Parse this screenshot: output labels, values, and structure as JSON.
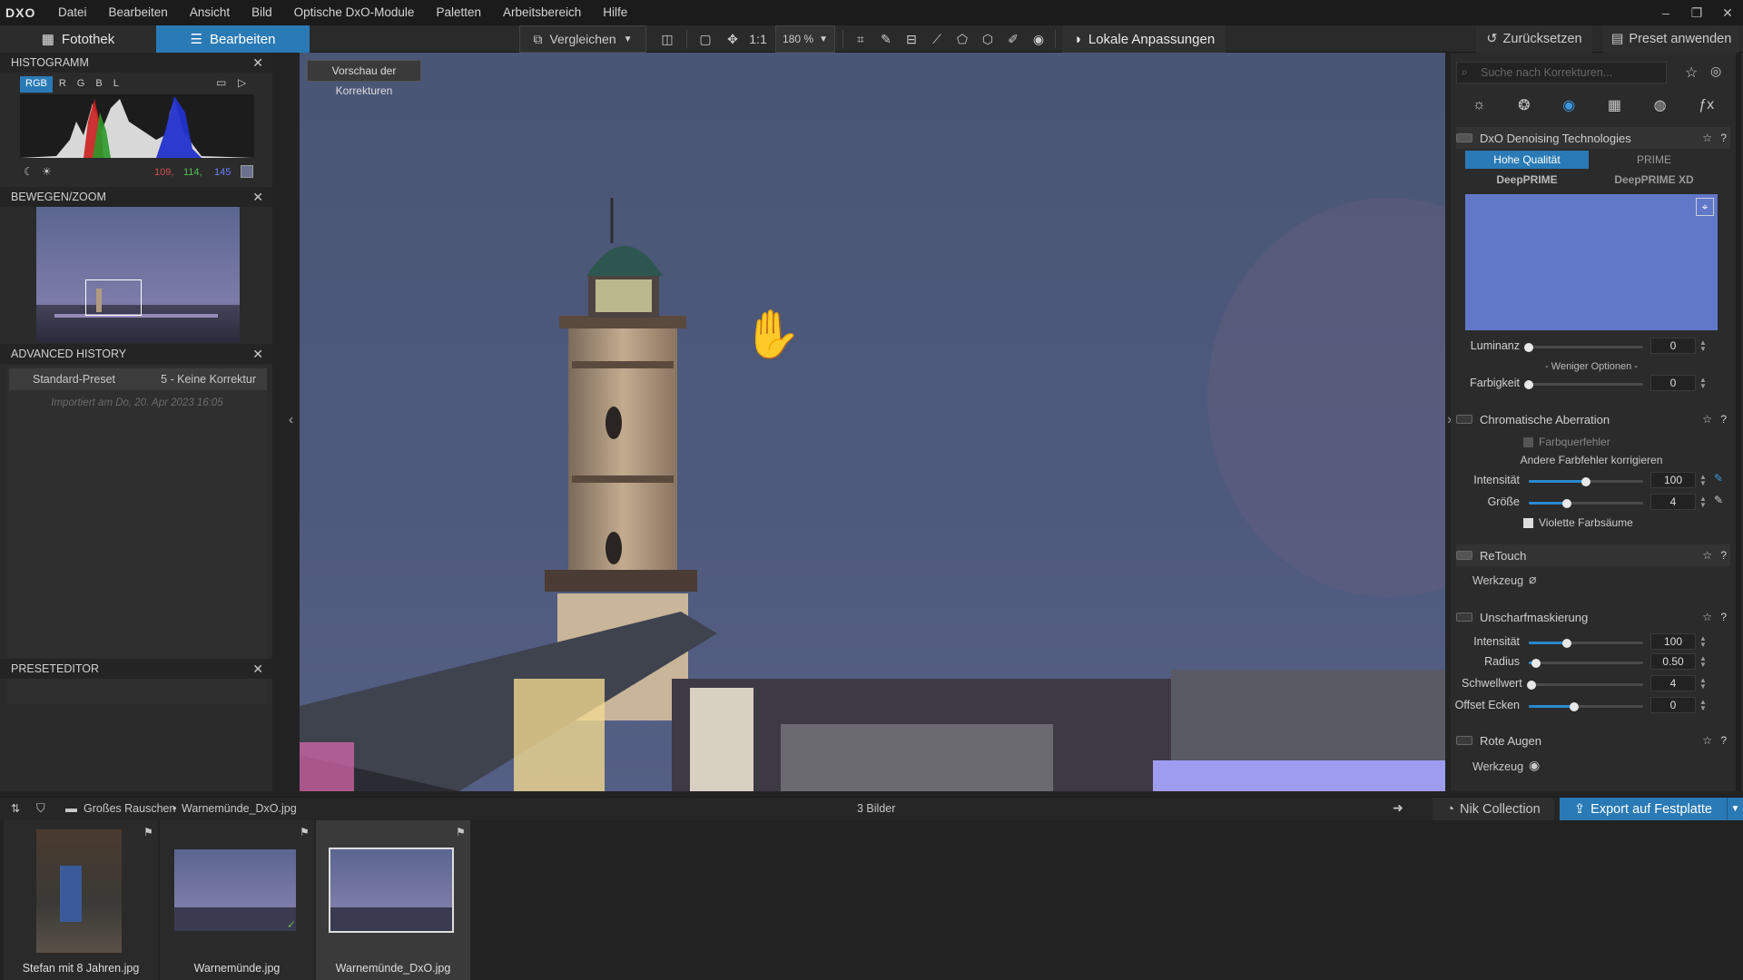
{
  "app": {
    "logo": "DXO"
  },
  "menu": [
    "Datei",
    "Bearbeiten",
    "Ansicht",
    "Bild",
    "Optische DxO-Module",
    "Paletten",
    "Arbeitsbereich",
    "Hilfe"
  ],
  "window_controls": [
    "–",
    "❐",
    "✕"
  ],
  "toolbar": {
    "tab_fotothek": "Fotothek",
    "tab_bearbeiten": "Bearbeiten",
    "vergleichen": "Vergleichen",
    "one_to_one": "1:1",
    "zoom": "180 %",
    "lokale_anpassungen": "Lokale Anpassungen",
    "zuruecksetzen": "Zurücksetzen",
    "preset_anwenden": "Preset anwenden"
  },
  "histogram": {
    "title": "HISTOGRAMM",
    "channels": [
      "RGB",
      "R",
      "G",
      "B",
      "L"
    ],
    "r": "109,",
    "g": "114,",
    "b": "145"
  },
  "zoom_panel": {
    "title": "BEWEGEN/ZOOM"
  },
  "history": {
    "title": "ADVANCED HISTORY",
    "preset": "Standard-Preset",
    "correction": "5 - Keine Korrektur",
    "imported": "Importiert am Do, 20. Apr 2023 16:05"
  },
  "preset_editor": {
    "title": "PRESETEDITOR"
  },
  "viewer": {
    "preview_label": "Vorschau der Korrekturen"
  },
  "right": {
    "search_placeholder": "Suche nach Korrekturen...",
    "denoise": {
      "title": "DxO Denoising Technologies",
      "modes": [
        "Hohe Qualität",
        "PRIME",
        "DeepPRIME",
        "DeepPRIME XD"
      ],
      "luminanz_label": "Luminanz",
      "luminanz": "0",
      "weniger": "- Weniger Optionen -",
      "farbigkeit_label": "Farbigkeit",
      "farbigkeit": "0"
    },
    "chroma": {
      "title": "Chromatische Aberration",
      "farbquerfehler": "Farbquerfehler",
      "andere": "Andere Farbfehler korrigieren",
      "intensitaet_label": "Intensität",
      "intensitaet": "100",
      "groesse_label": "Größe",
      "groesse": "4",
      "violett": "Violette Farbsäume"
    },
    "retouch": {
      "title": "ReTouch",
      "werkzeug": "Werkzeug"
    },
    "unscharf": {
      "title": "Unscharfmaskierung",
      "intensitaet_label": "Intensität",
      "intensitaet": "100",
      "radius_label": "Radius",
      "radius": "0.50",
      "schwellwert_label": "Schwellwert",
      "schwellwert": "4",
      "offset_label": "Offset Ecken",
      "offset": "0"
    },
    "rote_augen": {
      "title": "Rote Augen",
      "werkzeug": "Werkzeug"
    }
  },
  "slider_levels": {
    "luminanz": 0,
    "farbigkeit": 0,
    "chroma_intensitaet": 0.5,
    "chroma_groesse": 0.33,
    "unscharf_intensitaet": 0.33,
    "radius": 0.06,
    "schwellwert": 0.02,
    "offset": 0.4
  },
  "status": {
    "folder": "Großes Rauschen",
    "sep": "•",
    "file": "Warnemünde_DxO.jpg",
    "count": "3 Bilder",
    "nik": "Nik Collection",
    "export": "Export auf Festplatte"
  },
  "filmstrip": [
    {
      "name": "Stefan mit 8 Jahren.jpg"
    },
    {
      "name": "Warnemünde.jpg"
    },
    {
      "name": "Warnemünde_DxO.jpg"
    }
  ],
  "colors": {
    "accent": "#2a7ab5",
    "sky": "#4a5673"
  }
}
